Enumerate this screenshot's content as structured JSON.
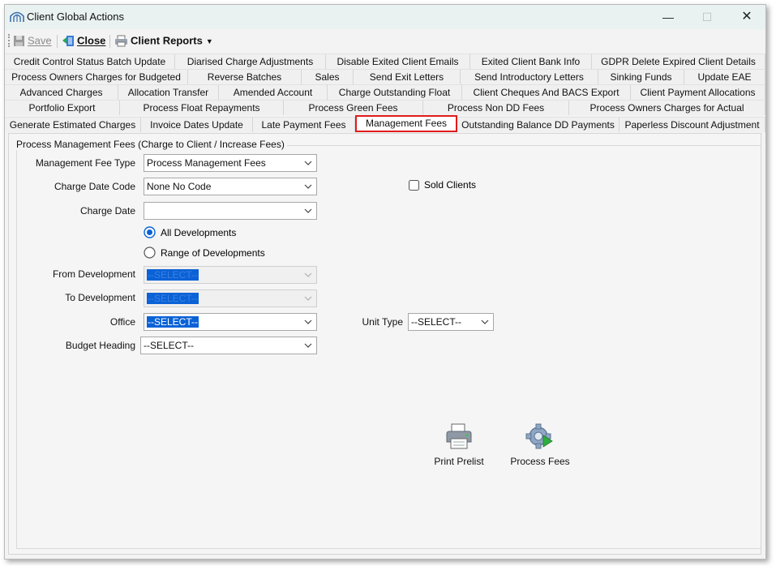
{
  "window": {
    "title": "Client Global Actions",
    "controls": {
      "minimize": "—",
      "maximize": "☐",
      "close": "✕"
    }
  },
  "toolbar": {
    "save_label": "Save",
    "close_label": "Close",
    "reports_label": "Client Reports"
  },
  "tabs": {
    "row1": [
      "Credit Control Status Batch Update",
      "Diarised Charge Adjustments",
      "Disable Exited Client Emails",
      "Exited Client Bank Info",
      "GDPR Delete Expired Client Details"
    ],
    "row2": [
      "Process Owners Charges for Budgeted",
      "Reverse  Batches",
      "Sales",
      "Send Exit Letters",
      "Send Introductory Letters",
      "Sinking Funds",
      "Update EAE"
    ],
    "row3": [
      "Advanced Charges",
      "Allocation Transfer",
      "Amended Account",
      "Charge Outstanding Float",
      "Client Cheques And BACS Export",
      "Client Payment Allocations"
    ],
    "row4": [
      "Portfolio Export",
      "Process Float Repayments",
      "Process Green Fees",
      "Process Non DD Fees",
      "Process Owners Charges for Actual"
    ],
    "row5": [
      "Generate Estimated Charges",
      "Invoice Dates Update",
      "Late Payment Fees",
      "Management Fees",
      "Outstanding Balance DD Payments",
      "Paperless Discount Adjustment"
    ],
    "active": "Management Fees"
  },
  "form": {
    "group_title": "Process Management Fees (Charge to Client / Increase Fees)",
    "fee_type": {
      "label": "Management Fee Type",
      "value": "Process Management Fees"
    },
    "charge_date_code": {
      "label": "Charge Date Code",
      "value": "None No Code"
    },
    "charge_date": {
      "label": "Charge Date",
      "value": ""
    },
    "sold_clients": {
      "label": "Sold Clients",
      "checked": false
    },
    "radio_all": {
      "label": "All Developments",
      "selected": true
    },
    "radio_range": {
      "label": "Range of Developments",
      "selected": false
    },
    "from_development": {
      "label": "From Development",
      "value": "--SELECT--"
    },
    "to_development": {
      "label": "To Development",
      "value": "--SELECT--"
    },
    "office": {
      "label": "Office",
      "value": "--SELECT--"
    },
    "unit_type": {
      "label": "Unit Type",
      "value": "--SELECT--"
    },
    "budget_heading": {
      "label": "Budget Heading",
      "value": "--SELECT--"
    }
  },
  "actions": {
    "print_prelist": "Print Prelist",
    "process_fees": "Process Fees"
  },
  "colors": {
    "highlight_border": "#e01b1b",
    "selection": "#0a62d6",
    "radio_fill": "#0a62d6"
  }
}
